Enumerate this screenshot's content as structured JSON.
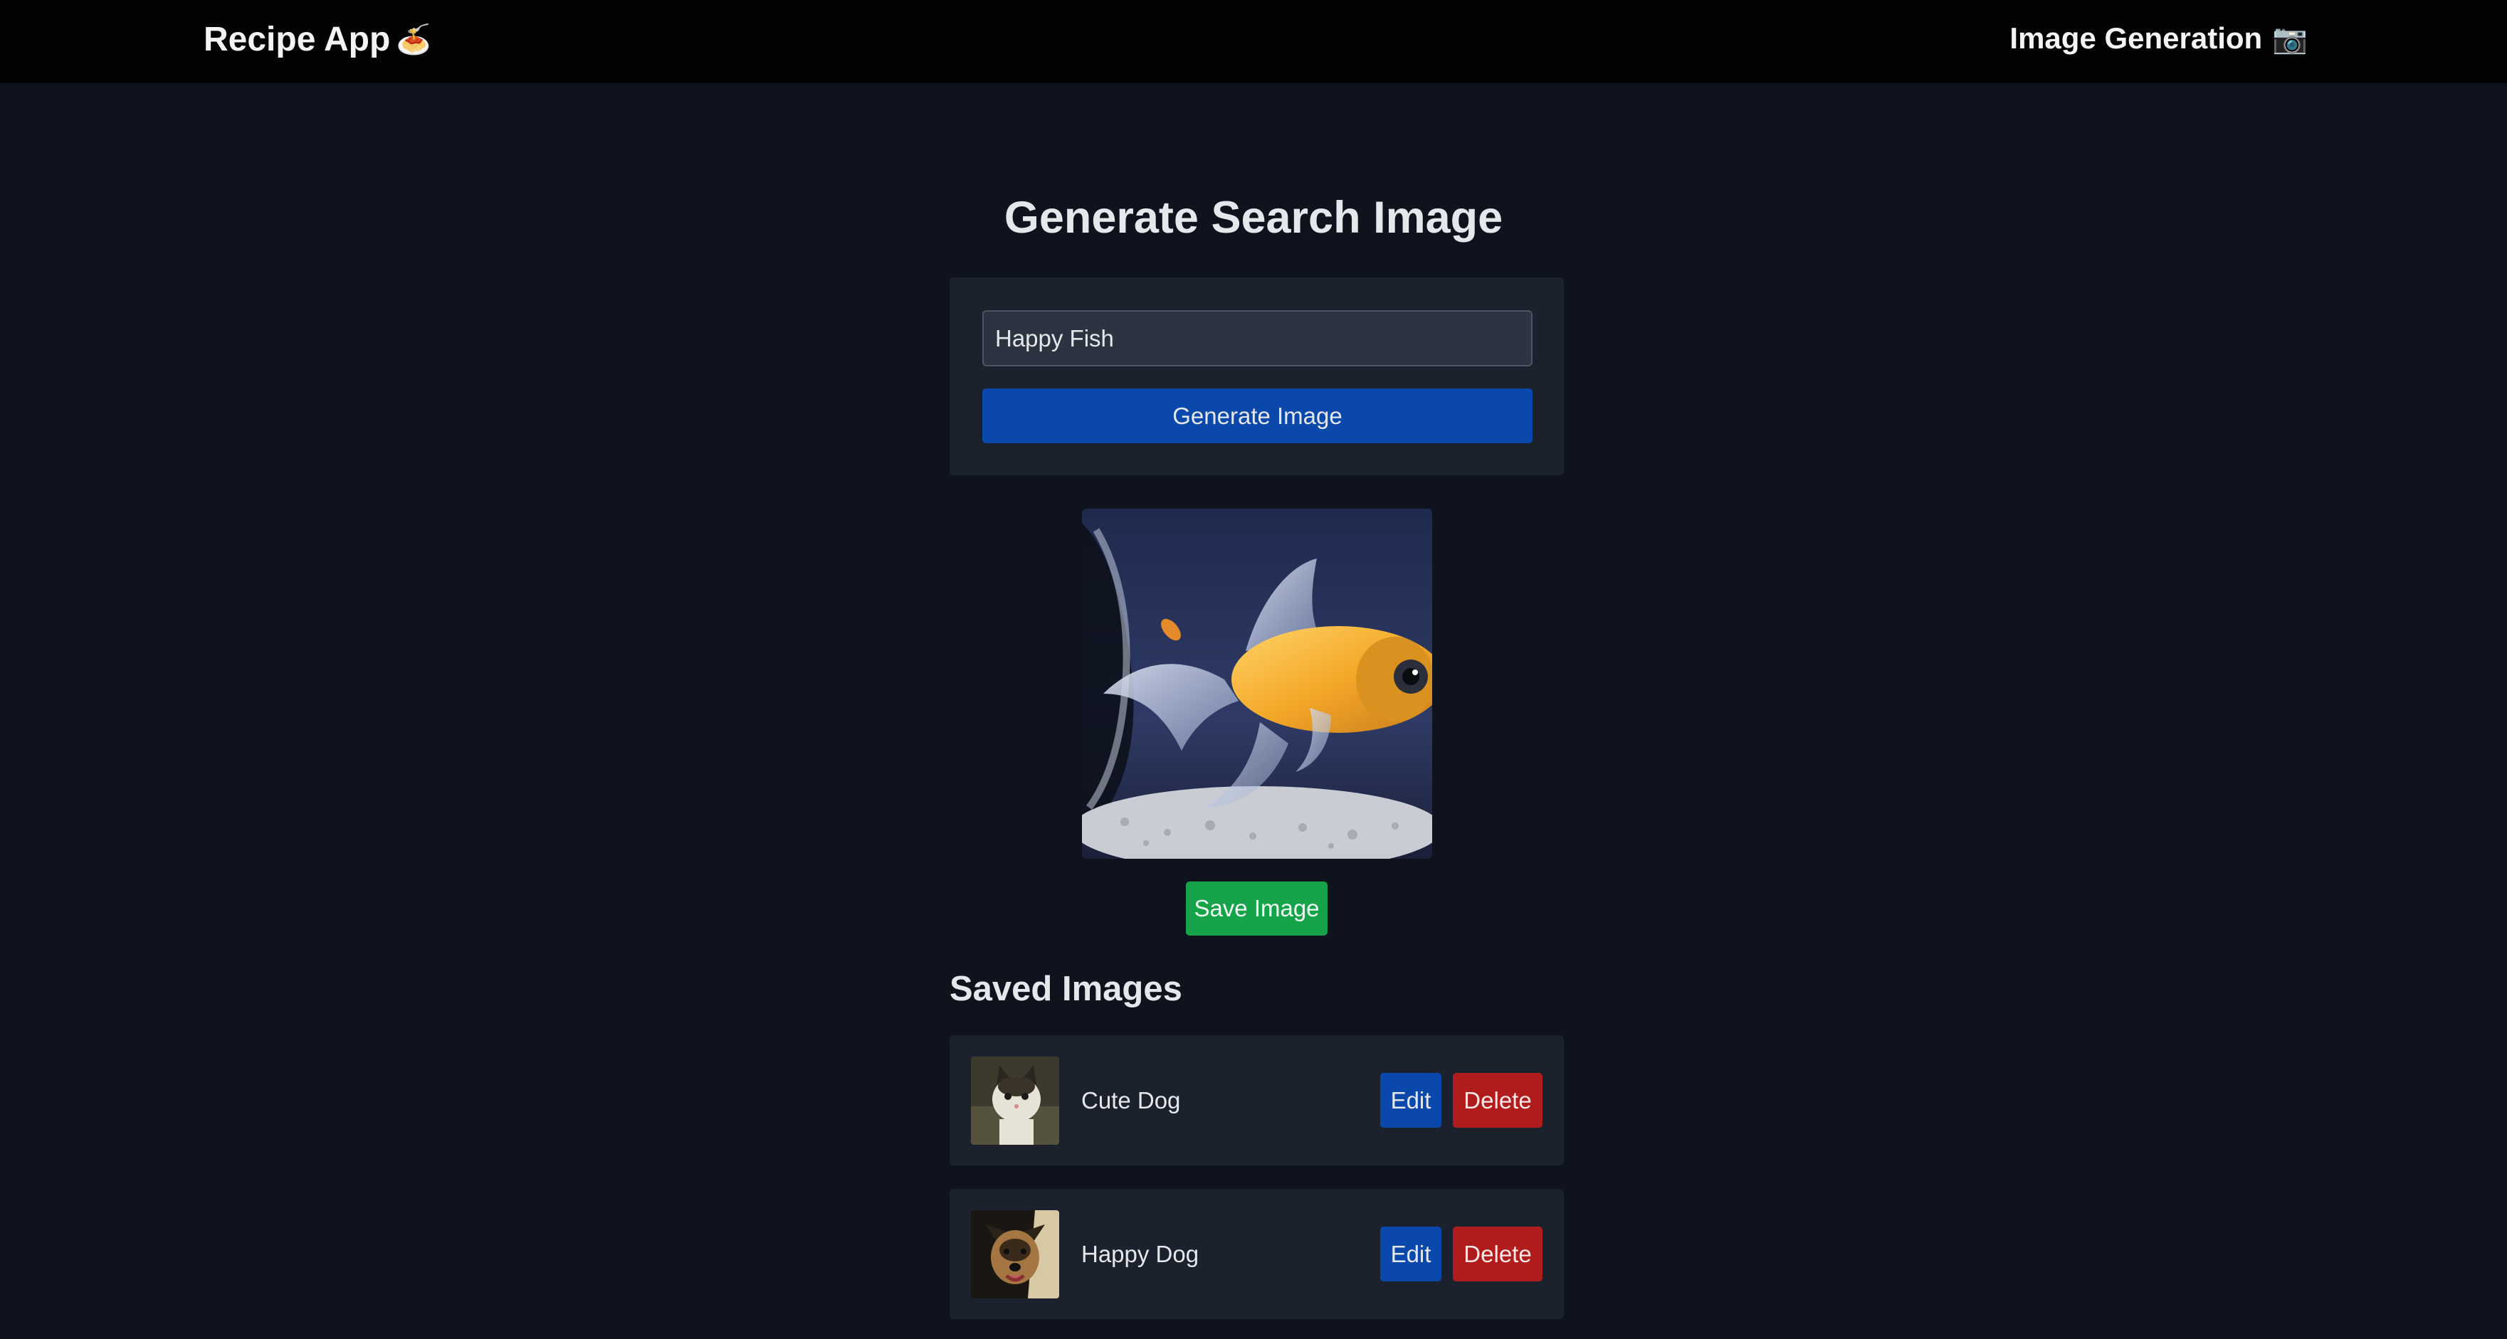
{
  "navbar": {
    "brand": "Recipe App",
    "brand_emoji": "🍝",
    "link_label": "Image Generation",
    "link_emoji": "📷"
  },
  "main": {
    "title": "Generate Search Image",
    "search_value": "Happy Fish",
    "generate_label": "Generate Image",
    "save_label": "Save Image"
  },
  "saved": {
    "heading": "Saved Images",
    "items": [
      {
        "name": "Cute Dog",
        "edit_label": "Edit",
        "delete_label": "Delete"
      },
      {
        "name": "Happy Dog",
        "edit_label": "Edit",
        "delete_label": "Delete"
      }
    ]
  },
  "colors": {
    "background": "#0f131d",
    "navbar": "#030303",
    "card": "#1b222d",
    "primary": "#0b48ab",
    "success": "#16a34a",
    "danger": "#b01b1b"
  }
}
